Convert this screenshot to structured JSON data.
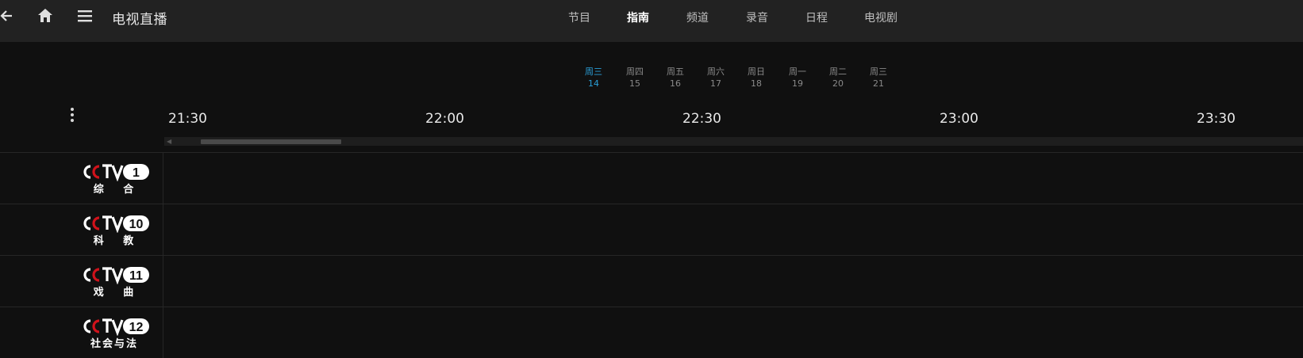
{
  "header": {
    "title": "电视直播",
    "back_icon": "arrow-left-icon",
    "home_icon": "home-icon",
    "menu_icon": "hamburger-menu-icon"
  },
  "tabs": [
    {
      "label": "节目",
      "active": false
    },
    {
      "label": "指南",
      "active": true
    },
    {
      "label": "频道",
      "active": false
    },
    {
      "label": "录音",
      "active": false
    },
    {
      "label": "日程",
      "active": false
    },
    {
      "label": "电视剧",
      "active": false
    }
  ],
  "days": [
    {
      "weekday": "周三",
      "date": "14",
      "active": true
    },
    {
      "weekday": "周四",
      "date": "15",
      "active": false
    },
    {
      "weekday": "周五",
      "date": "16",
      "active": false
    },
    {
      "weekday": "周六",
      "date": "17",
      "active": false
    },
    {
      "weekday": "周日",
      "date": "18",
      "active": false
    },
    {
      "weekday": "周一",
      "date": "19",
      "active": false
    },
    {
      "weekday": "周二",
      "date": "20",
      "active": false
    },
    {
      "weekday": "周三",
      "date": "21",
      "active": false
    }
  ],
  "timeline": [
    "21:30",
    "22:00",
    "22:30",
    "23:00",
    "23:30"
  ],
  "channels": [
    {
      "logo_text": "CCTV",
      "number": "1",
      "subtitle": "综 合"
    },
    {
      "logo_text": "CCTV",
      "number": "10",
      "subtitle": "科 教"
    },
    {
      "logo_text": "CCTV",
      "number": "11",
      "subtitle": "戏 曲"
    },
    {
      "logo_text": "CCTV",
      "number": "12",
      "subtitle": "社会与法"
    }
  ],
  "colors": {
    "accent": "#2a9fd8",
    "topbar": "#222222",
    "background": "#101010",
    "cctv_red": "#d0121b"
  }
}
